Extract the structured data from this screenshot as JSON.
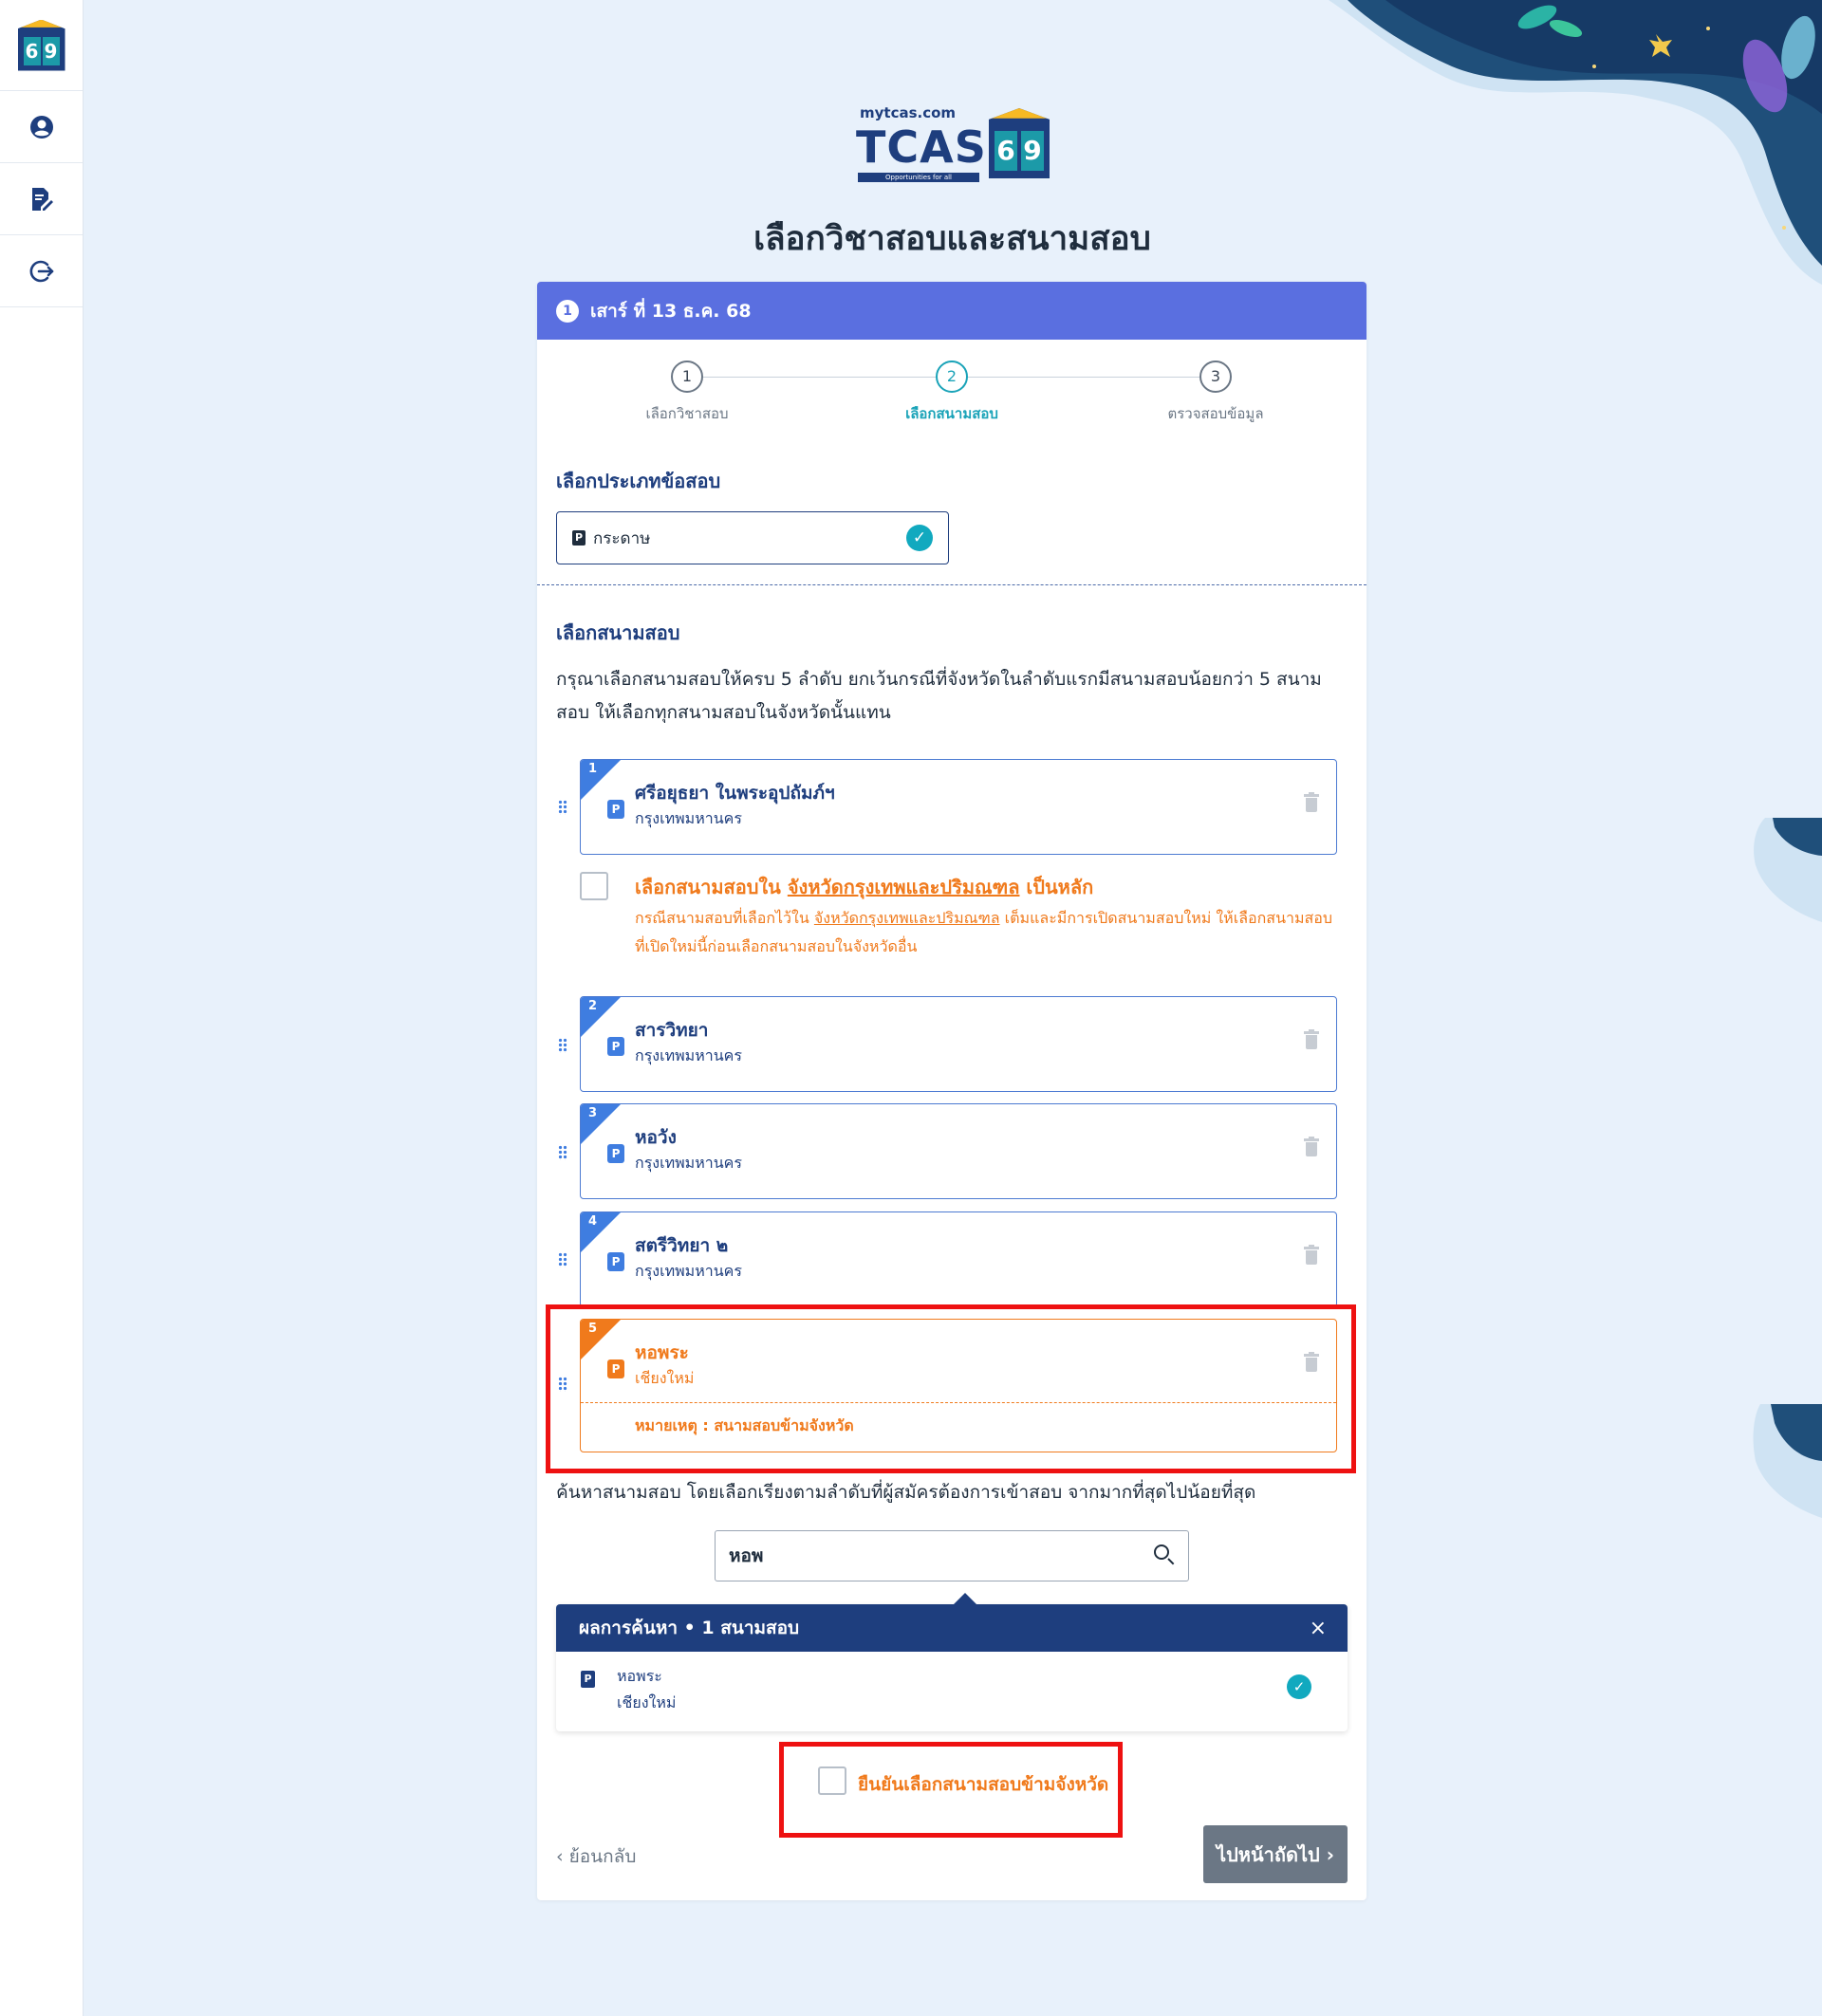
{
  "sidebar": {
    "logo_digits": [
      "6",
      "9"
    ],
    "items": [
      {
        "name": "profile",
        "icon": "user-circle-icon"
      },
      {
        "name": "exam-registration",
        "icon": "document-edit-icon"
      },
      {
        "name": "logout",
        "icon": "logout-icon"
      }
    ]
  },
  "brand": {
    "site": "mytcas.com",
    "tcas": "TCAS",
    "tagline": "Opportunities for all",
    "digit_6": "6",
    "digit_9": "9"
  },
  "page_title": "เลือกวิชาสอบและสนามสอบ",
  "card": {
    "header_number": "1",
    "header_text": "เสาร์ ที่ 13 ธ.ค. 68",
    "steps": [
      {
        "num": "1",
        "label": "เลือกวิชาสอบ",
        "active": false
      },
      {
        "num": "2",
        "label": "เลือกสนามสอบ",
        "active": true
      },
      {
        "num": "3",
        "label": "ตรวจสอบข้อมูล",
        "active": false
      }
    ],
    "exam_type_title": "เลือกประเภทข้อสอบ",
    "exam_type_icon_text": "P",
    "exam_type_value": "กระดาษ",
    "venue_title": "เลือกสนามสอบ",
    "instruction": "กรุณาเลือกสนามสอบให้ครบ 5 ลำดับ ยกเว้นกรณีที่จังหวัดในลำดับแรกมีสนามสอบน้อยกว่า 5 สนามสอบ ให้เลือกทุกสนามสอบในจังหวัดนั้นแทน",
    "venues": [
      {
        "rank": "1",
        "name": "ศรีอยุธยา ในพระอุปถัมภ์ฯ",
        "province": "กรุงเทพมหานคร"
      },
      {
        "rank": "2",
        "name": "สารวิทยา",
        "province": "กรุงเทพมหานคร"
      },
      {
        "rank": "3",
        "name": "หอวัง",
        "province": "กรุงเทพมหานคร"
      },
      {
        "rank": "4",
        "name": "สตรีวิทยา ๒",
        "province": "กรุงเทพมหานคร"
      },
      {
        "rank": "5",
        "name": "หอพระ",
        "province": "เชียงใหม่",
        "note": "หมายเหตุ : สนามสอบข้ามจังหวัด"
      }
    ],
    "primary_province": {
      "prefix": "เลือกสนามสอบใน ",
      "province": "จังหวัดกรุงเทพและปริมณฑล",
      "suffix": " เป็นหลัก",
      "desc_prefix": "กรณีสนามสอบที่เลือกไว้ใน ",
      "desc_province": "จังหวัดกรุงเทพและปริมณฑล",
      "desc_suffix": " เต็มและมีการเปิดสนามสอบใหม่ ให้เลือกสนามสอบที่เปิดใหม่นี้ก่อนเลือกสนามสอบในจังหวัดอื่น"
    },
    "search_hint": "ค้นหาสนามสอบ โดยเลือกเรียงตามลำดับที่ผู้สมัครต้องการเข้าสอบ จากมากที่สุดไปน้อยที่สุด",
    "search_value": "หอพ",
    "results": {
      "header": "ผลการค้นหา • 1 สนามสอบ",
      "close": "×",
      "items": [
        {
          "name": "หอพระ",
          "province": "เชียงใหม่"
        }
      ]
    },
    "confirm_label": "ยืนยันเลือกสนามสอบข้ามจังหวัด",
    "back_label": "‹  ย้อนกลับ",
    "next_label": "ไปหน้าถัดไป  ›"
  },
  "colors": {
    "header_bar": "#5a6fe0",
    "accent_blue": "#3f7de0",
    "navy": "#1e3e7e",
    "orange": "#f07a1c",
    "teal": "#11a9bf",
    "annotation_red": "#ee1111"
  }
}
